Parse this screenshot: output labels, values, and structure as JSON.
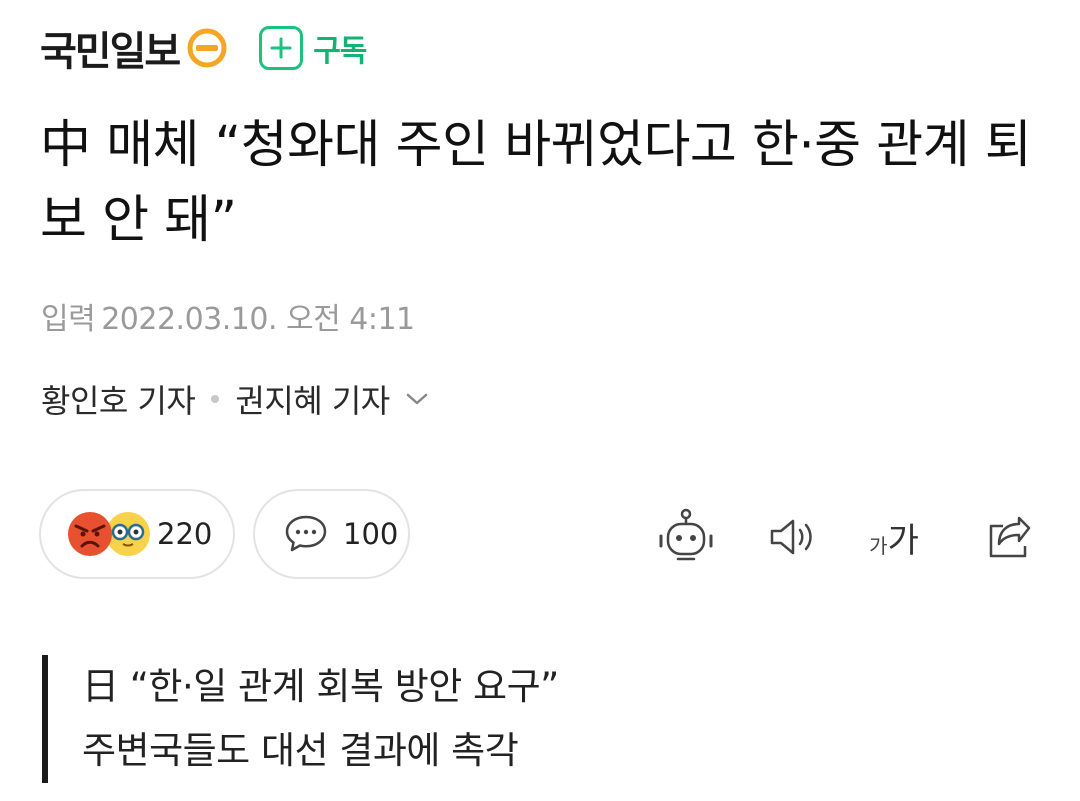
{
  "press": {
    "name": "국민일보",
    "subscribe_label": "구독"
  },
  "headline": "中 매체 “청와대 주인 바뀌었다고 한·중 관계 퇴보 안 돼”",
  "meta": {
    "label": "입력",
    "datetime": "2022.03.10. 오전 4:11"
  },
  "reporters": [
    "황인호 기자",
    "권지혜 기자"
  ],
  "reactions": {
    "count": "220",
    "icons": [
      "angry-face-icon",
      "glasses-face-icon"
    ]
  },
  "comments": {
    "count": "100"
  },
  "toolbar": {
    "font_small": "가",
    "font_large": "가"
  },
  "summary": [
    "日 “한·일 관계 회복 방안 요구”",
    "주변국들도 대선 결과에 촉각"
  ],
  "colors": {
    "accent_green": "#19c37d",
    "logo_orange": "#f5a623",
    "angry_red": "#e8512f",
    "meta_gray": "#9a9a9a"
  }
}
